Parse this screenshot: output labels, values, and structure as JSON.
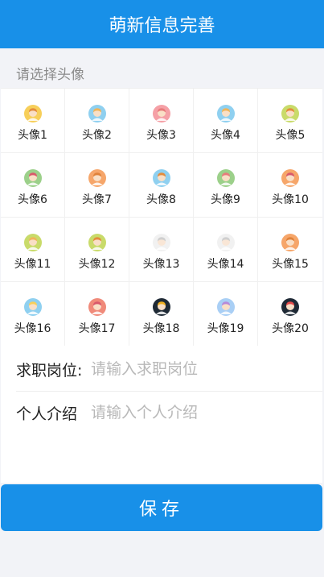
{
  "header": {
    "title": "萌新信息完善"
  },
  "avatar_section": {
    "label": "请选择头像",
    "avatars": [
      {
        "label": "头像1",
        "bg": "#f7cf5a",
        "face": "#f9dfc6",
        "hair": "#e48c3c"
      },
      {
        "label": "头像2",
        "bg": "#8fd0f0",
        "face": "#f9dfc6",
        "hair": "#f0b45a"
      },
      {
        "label": "头像3",
        "bg": "#f5a0a6",
        "face": "#f9dfc6",
        "hair": "#e87b7b"
      },
      {
        "label": "头像4",
        "bg": "#8fd0f0",
        "face": "#f9dfc6",
        "hair": "#f0b45a"
      },
      {
        "label": "头像5",
        "bg": "#c9db6a",
        "face": "#f9dfc6",
        "hair": "#e48c3c"
      },
      {
        "label": "头像6",
        "bg": "#9cd08a",
        "face": "#f9dfc6",
        "hair": "#d9596b"
      },
      {
        "label": "头像7",
        "bg": "#f6a66a",
        "face": "#f9dfc6",
        "hair": "#e0823a"
      },
      {
        "label": "头像8",
        "bg": "#8fd0f0",
        "face": "#f9dfc6",
        "hair": "#e48c3c"
      },
      {
        "label": "头像9",
        "bg": "#9cd08a",
        "face": "#f9dfc6",
        "hair": "#e87b7b"
      },
      {
        "label": "头像10",
        "bg": "#f6a66a",
        "face": "#f9dfc6",
        "hair": "#d9596b"
      },
      {
        "label": "头像11",
        "bg": "#c9db6a",
        "face": "#f9dfc6",
        "hair": "#f0b45a"
      },
      {
        "label": "头像12",
        "bg": "#c9db6a",
        "face": "#f9dfc6",
        "hair": "#e48c3c"
      },
      {
        "label": "头像13",
        "bg": "#f1f1f1",
        "face": "#f9e6d6",
        "hair": "#cfcfcf"
      },
      {
        "label": "头像14",
        "bg": "#f1f1f1",
        "face": "#f9e6d6",
        "hair": "#cfcfcf"
      },
      {
        "label": "头像15",
        "bg": "#f6a66a",
        "face": "#f9dfc6",
        "hair": "#e0823a"
      },
      {
        "label": "头像16",
        "bg": "#8fd0f0",
        "face": "#f9dfc6",
        "hair": "#f7cf5a"
      },
      {
        "label": "头像17",
        "bg": "#f08a7a",
        "face": "#f9dfc6",
        "hair": "#d9596b"
      },
      {
        "label": "头像18",
        "bg": "#1f2a36",
        "face": "#f9dfc6",
        "hair": "#f0b020"
      },
      {
        "label": "头像19",
        "bg": "#a9cff5",
        "face": "#f9dfc6",
        "hair": "#b58ad9"
      },
      {
        "label": "头像20",
        "bg": "#1f2a36",
        "face": "#f9dfc6",
        "hair": "#e34a4a"
      }
    ]
  },
  "form": {
    "position": {
      "label": "求职岗位:",
      "placeholder": "请输入求职岗位",
      "value": ""
    },
    "intro": {
      "label": "个人介绍",
      "placeholder": "请输入个人介绍",
      "value": ""
    }
  },
  "save_label": "保存",
  "colors": {
    "primary": "#1890e8",
    "page_bg": "#f2f3f7"
  }
}
